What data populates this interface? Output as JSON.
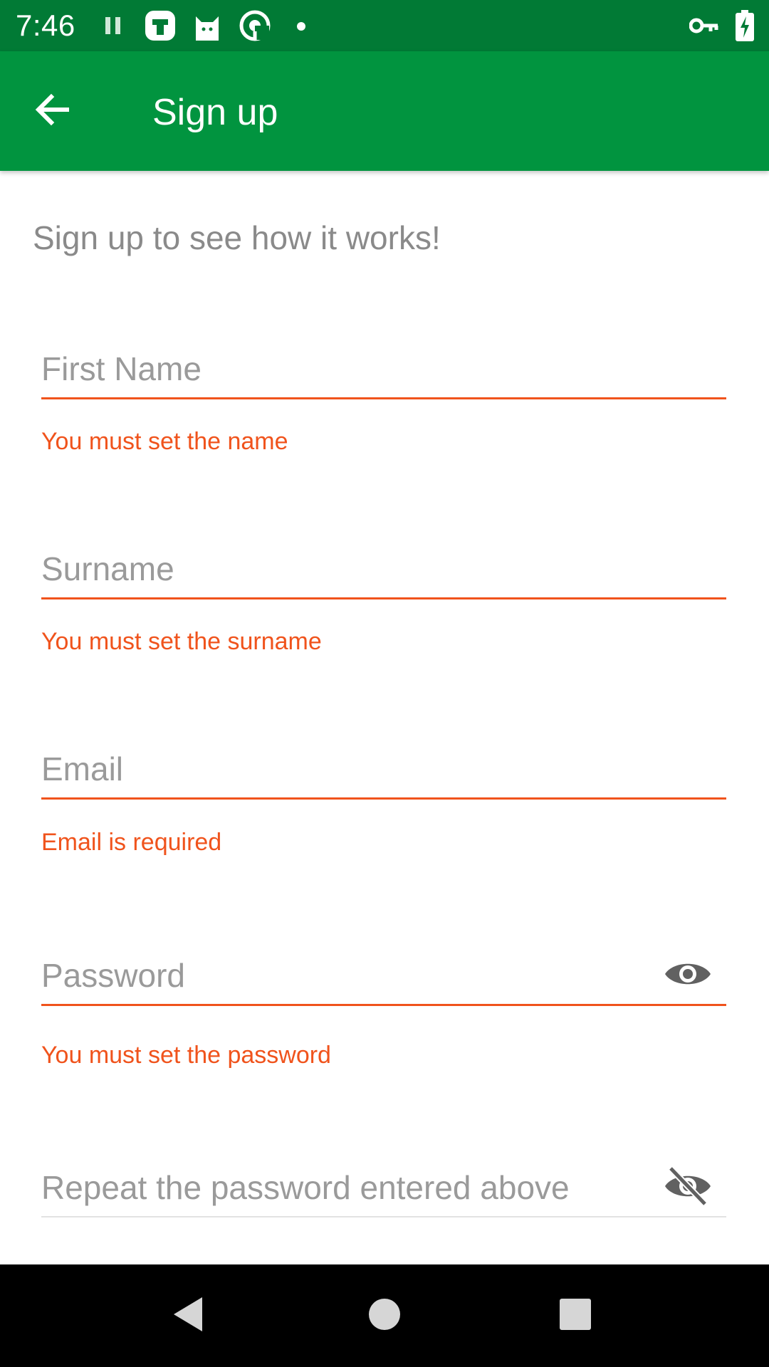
{
  "status_bar": {
    "time": "7:46",
    "background": "#017a35",
    "icons": [
      "pause-icon",
      "notification-app-icon",
      "cat-app-icon",
      "signal-app-icon",
      "dot-icon",
      "vpn-key-icon",
      "battery-charging-icon"
    ]
  },
  "app_bar": {
    "title": "Sign up",
    "background": "#01943f",
    "back_icon": "arrow-back-icon"
  },
  "form": {
    "intro": "Sign up to see how it works!",
    "first_name": {
      "placeholder": "First Name",
      "value": "",
      "error": "You must set the name"
    },
    "surname": {
      "placeholder": "Surname",
      "value": "",
      "error": "You must set the surname"
    },
    "email": {
      "placeholder": "Email",
      "value": "",
      "error": "Email is required"
    },
    "password": {
      "placeholder": "Password",
      "value": "",
      "error": "You must set the password",
      "toggle_icon": "eye-icon"
    },
    "repeat_password": {
      "placeholder": "Repeat the password entered above",
      "value": "",
      "toggle_icon": "eye-off-icon"
    },
    "error_color": "#f0531c",
    "hint_color": "#9a9a9a"
  },
  "nav_bar": {
    "buttons": [
      "back-triangle-icon",
      "home-circle-icon",
      "recents-square-icon"
    ]
  }
}
